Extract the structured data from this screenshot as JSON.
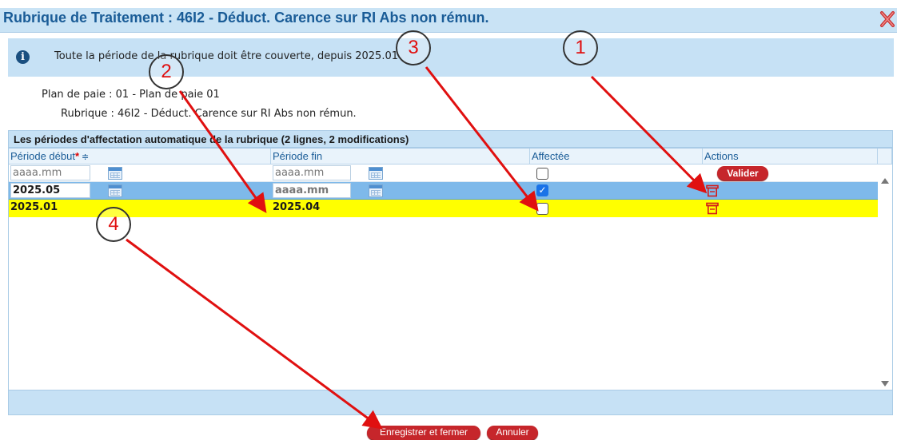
{
  "window": {
    "title": "Rubrique de Traitement : 46I2 - Déduct. Carence sur RI Abs non rémun.",
    "close_icon": "close-x-icon"
  },
  "info": {
    "icon": "info-icon",
    "icon_glyph": "i",
    "message": "Toute la période de la rubrique doit être couverte, depuis 2025.01"
  },
  "meta": {
    "plan_de_paie": "Plan de paie : 01 - Plan de paie 01",
    "rubrique": "Rubrique : 46I2 - Déduct. Carence sur RI Abs non rémun."
  },
  "section": {
    "title": "Les périodes d'affectation automatique de la rubrique (2 lignes, 2 modifications)"
  },
  "table": {
    "columns": {
      "periode_debut": "Période début",
      "required_star": "*",
      "sort_glyph": "≑",
      "periode_fin": "Période fin",
      "affectee": "Affectée",
      "actions": "Actions"
    },
    "new_row": {
      "debut_placeholder": "aaaa.mm",
      "fin_placeholder": "aaaa.mm",
      "valider_label": "Valider",
      "affectee_checked": false
    },
    "rows": [
      {
        "debut": "2025.05",
        "fin": "",
        "fin_placeholder": "aaaa.mm",
        "affectee_checked": true,
        "check_glyph": "✓",
        "highlight": "#7eb9ea"
      },
      {
        "debut": "2025.01",
        "fin": "2025.04",
        "affectee_checked": false,
        "highlight": "#ffff00"
      }
    ]
  },
  "footer": {
    "save_label": "Enregistrer et fermer",
    "cancel_label": "Annuler"
  },
  "annotations": [
    "1",
    "2",
    "3",
    "4"
  ],
  "colors": {
    "accent": "#1a5c97",
    "header_bg": "#c6e1f5",
    "button_red": "#c6262b",
    "annotation_arrow": "#e01010"
  }
}
